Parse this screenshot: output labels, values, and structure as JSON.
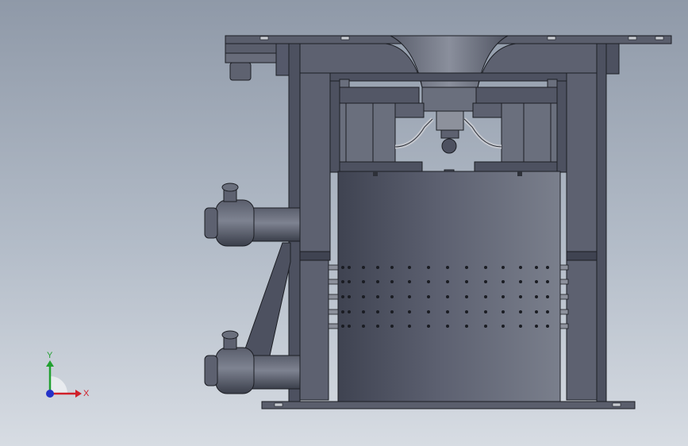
{
  "viewport": {
    "background_top": "#8f99a8",
    "background_bottom": "#d7dce3",
    "model_body_color": "#4d5160",
    "model_shade_color": "#6a6f7d"
  },
  "triad": {
    "x_label": "X",
    "y_label": "Y",
    "x_color": "#d0202a",
    "y_color": "#21a030",
    "z_color": "#2432c8"
  }
}
